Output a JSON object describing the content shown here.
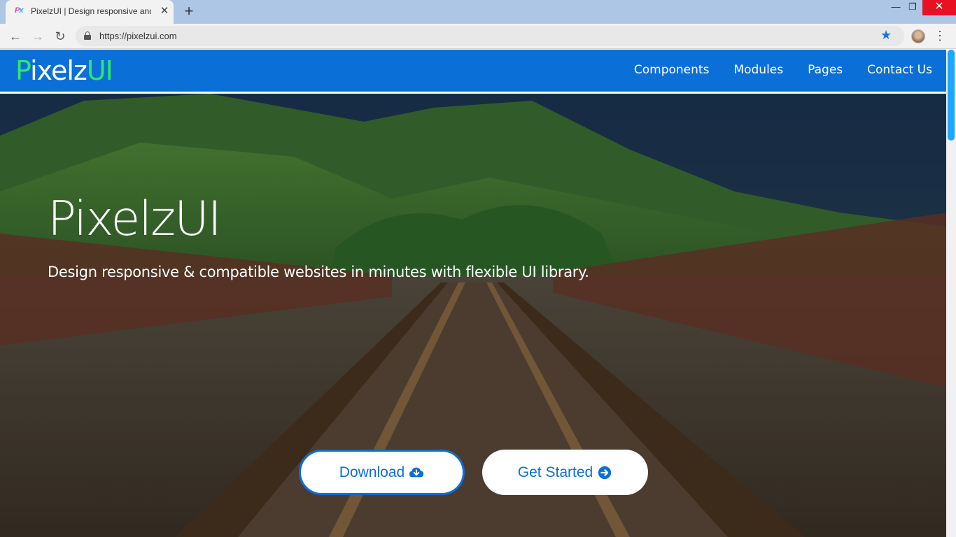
{
  "browser": {
    "tab_title": "PixelzUI | Design responsive and",
    "favicon_text_1": "P",
    "favicon_text_2": "x",
    "tab_close": "✕",
    "new_tab": "+",
    "win_min": "—",
    "win_max": "❐",
    "win_close": "✕",
    "back": "←",
    "forward": "→",
    "reload": "↻",
    "url": "https://pixelzui.com",
    "star": "★",
    "menu": "⋮"
  },
  "site": {
    "logo_p": "P",
    "logo_ixelz": "ixelz",
    "logo_ui": "UI",
    "nav": [
      "Components",
      "Modules",
      "Pages",
      "Contact Us"
    ],
    "hero_title": "PixelzUI",
    "hero_subtitle": "Design responsive & compatible websites in minutes with flexible UI library.",
    "download_label": "Download",
    "get_started_label": "Get Started"
  },
  "colors": {
    "navbar": "#0b6fd8",
    "logo_accent": "#2ee86c",
    "button_text": "#0b6fd8"
  }
}
